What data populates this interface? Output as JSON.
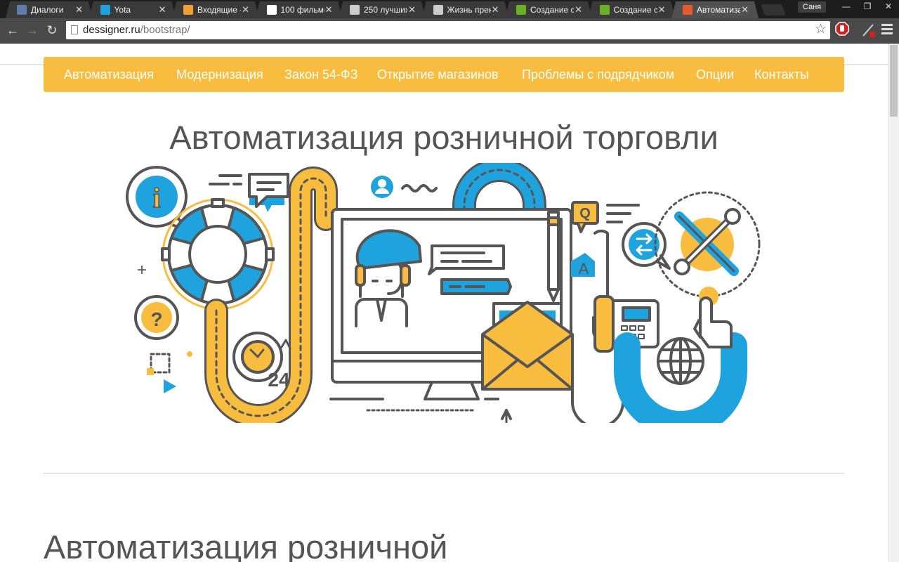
{
  "browser": {
    "tabs": [
      {
        "title": "Диалоги",
        "icon": "vk-icon",
        "color": "#5b7fa8"
      },
      {
        "title": "Yota",
        "icon": "yota-icon",
        "color": "#1ea1de"
      },
      {
        "title": "Входящие -",
        "icon": "mail-icon",
        "color": "#f0a030"
      },
      {
        "title": "100 фильмо",
        "icon": "google-icon",
        "color": "#ffffff"
      },
      {
        "title": "250 лучших",
        "icon": "film-reel-icon",
        "color": "#cccccc"
      },
      {
        "title": "Жизнь прек",
        "icon": "film-reel-icon",
        "color": "#cccccc"
      },
      {
        "title": "Создание с",
        "icon": "fl-ru-icon",
        "color": "#6ab023"
      },
      {
        "title": "Создание с",
        "icon": "fl-ru-icon",
        "color": "#6ab023"
      },
      {
        "title": "Автоматиза",
        "icon": "dessigner-icon",
        "color": "#e55a2b"
      }
    ],
    "active_tab": 8,
    "tab_close": "✕",
    "profile_name": "Саня",
    "window_controls": {
      "minimize": "—",
      "maximize": "❐",
      "close": "✕"
    },
    "nav": {
      "back": "←",
      "forward": "→",
      "reload": "↻"
    },
    "address": {
      "domain": "dessigner.ru",
      "path": "/bootstrap/"
    },
    "star": "☆"
  },
  "page": {
    "nav_items": [
      {
        "label": "Автоматизация"
      },
      {
        "label": "Модернизация"
      },
      {
        "label": "Закон 54-ФЗ"
      },
      {
        "label": "Открытие магазинов"
      },
      {
        "label": "Проблемы с подрядчиком"
      },
      {
        "label": "Опции"
      },
      {
        "label": "Контакты"
      }
    ],
    "hero_title": "Автоматизация розничной торговли",
    "section_title": "Автоматизация розничной",
    "illustration": {
      "info_mark": "i",
      "question_mark": "?",
      "clock_label": "24",
      "email_symbol": "@",
      "letter_a": "A",
      "letter_q": "Q",
      "plus_sign": "+"
    }
  },
  "colors": {
    "accent": "#f8bd3e",
    "blue": "#1fa3de",
    "outline": "#555555"
  }
}
